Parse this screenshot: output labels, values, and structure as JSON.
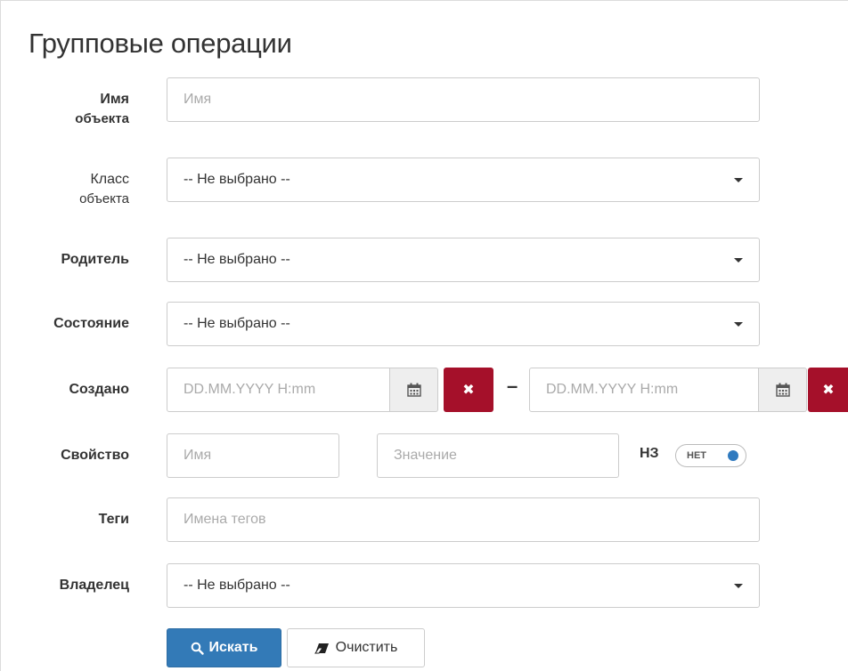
{
  "title": "Групповые операции",
  "fields": {
    "object_name": {
      "label_line1": "Имя",
      "label_line2": "объекта",
      "placeholder": "Имя"
    },
    "object_class": {
      "label_line1": "Класс",
      "label_line2": "объекта",
      "value": "-- Не выбрано --"
    },
    "parent": {
      "label": "Родитель",
      "value": "-- Не выбрано --"
    },
    "state": {
      "label": "Состояние",
      "value": "-- Не выбрано --"
    },
    "created": {
      "label": "Создано",
      "from_placeholder": "DD.MM.YYYY H:mm",
      "to_placeholder": "DD.MM.YYYY H:mm",
      "separator": "–",
      "clear_symbol": "✖"
    },
    "property": {
      "label": "Свойство",
      "name_placeholder": "Имя",
      "value_placeholder": "Значение",
      "nz_label": "НЗ",
      "toggle_text": "НЕТ"
    },
    "tags": {
      "label": "Теги",
      "placeholder": "Имена тегов"
    },
    "owner": {
      "label": "Владелец",
      "value": "-- Не выбрано --"
    }
  },
  "buttons": {
    "search": "Искать",
    "clear": "Очистить"
  },
  "icons": {
    "search": "search-icon",
    "eraser": "eraser-icon",
    "calendar": "calendar-icon",
    "dropdown": "chevron-down-icon"
  },
  "colors": {
    "primary": "#337ab7",
    "danger": "#a5102a",
    "toggle_knob": "#2f7abf"
  }
}
